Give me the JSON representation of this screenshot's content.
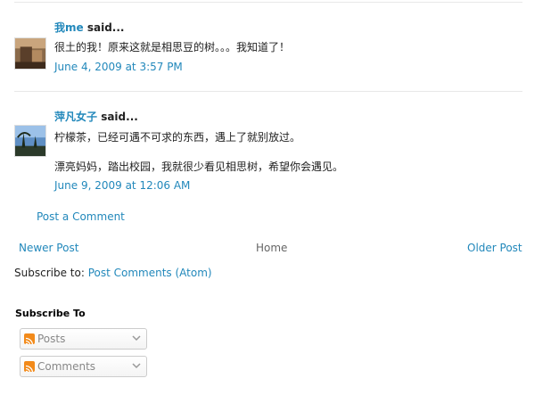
{
  "comments": [
    {
      "author": "我me",
      "said": " said...",
      "paragraphs": [
        "很土的我！原来这就是相思豆的树。。。我知道了！"
      ],
      "timestamp": "June 4, 2009 at 3:57 PM"
    },
    {
      "author": "萍凡女子",
      "said": " said...",
      "paragraphs": [
        "柠檬茶，已经可遇不可求的东西，遇上了就别放过。",
        "漂亮妈妈，踏出校园，我就很少看见相思树，希望你会遇见。"
      ],
      "timestamp": "June 9, 2009 at 12:06 AM"
    }
  ],
  "post_comment_label": "Post a Comment",
  "pager": {
    "newer": "Newer Post",
    "home": "Home",
    "older": "Older Post"
  },
  "subscribe": {
    "prefix": "Subscribe to: ",
    "link": "Post Comments (Atom)"
  },
  "widget": {
    "title": "Subscribe To",
    "options": [
      {
        "label": "Posts",
        "icon": "feed-icon"
      },
      {
        "label": "Comments",
        "icon": "feed-icon"
      }
    ]
  },
  "colors": {
    "link": "#2288bb",
    "text": "#222222",
    "muted": "#666666",
    "feed": "#f28a1a"
  }
}
